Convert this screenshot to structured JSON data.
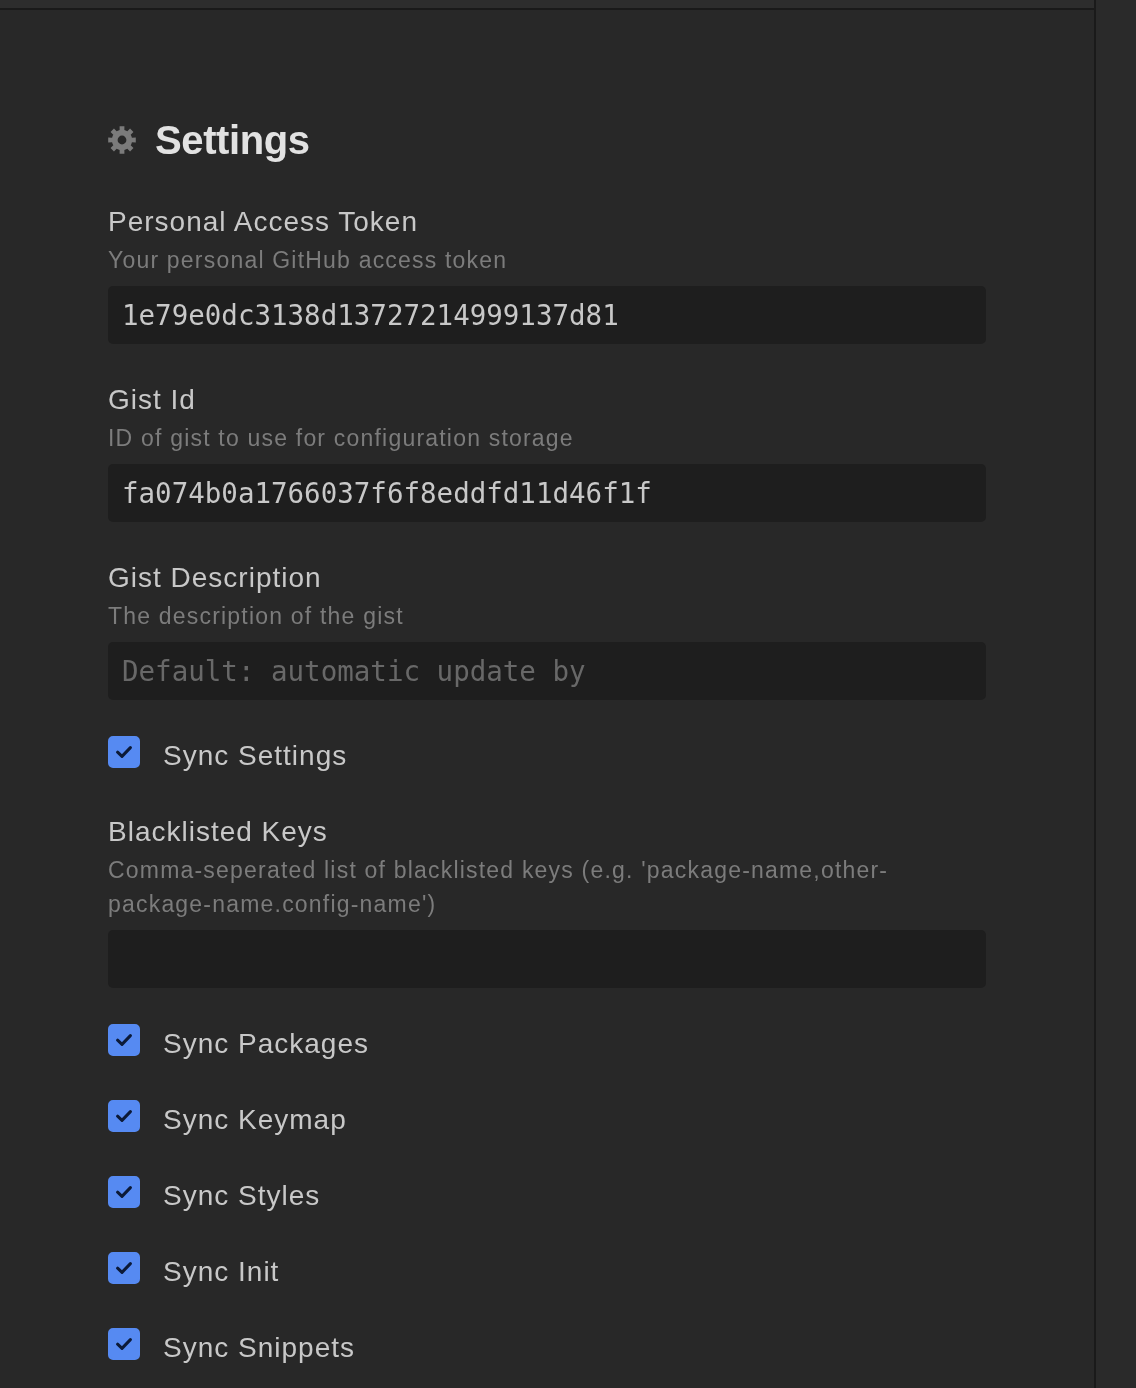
{
  "title": "Settings",
  "settings": [
    {
      "kind": "text",
      "label": "Personal Access Token",
      "description": "Your personal GitHub access token",
      "value": "1e79e0dc3138d13727214999137d81"
    },
    {
      "kind": "text",
      "label": "Gist Id",
      "description": "ID of gist to use for configuration storage",
      "value": "fa074b0a1766037f6f8eddfd11d46f1f"
    },
    {
      "kind": "text",
      "label": "Gist Description",
      "description": "The description of the gist",
      "placeholder": "Default: automatic update by"
    },
    {
      "kind": "checkbox",
      "label": "Sync Settings",
      "checked": true
    },
    {
      "kind": "text",
      "label": "Blacklisted Keys",
      "description": "Comma-seperated list of blacklisted keys (e.g. 'package-name,other-package-name.config-name')"
    },
    {
      "kind": "checkbox",
      "label": "Sync Packages",
      "checked": true
    },
    {
      "kind": "checkbox",
      "label": "Sync Keymap",
      "checked": true
    },
    {
      "kind": "checkbox",
      "label": "Sync Styles",
      "checked": true
    },
    {
      "kind": "checkbox",
      "label": "Sync Init",
      "checked": true
    },
    {
      "kind": "checkbox",
      "label": "Sync Snippets",
      "checked": true
    }
  ]
}
